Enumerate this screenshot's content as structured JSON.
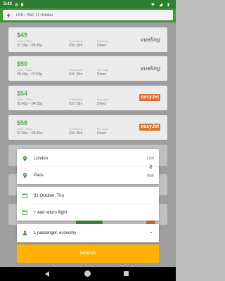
{
  "status_bar": {
    "time": "5:43"
  },
  "search": {
    "route": "LON • PAR, 31 October"
  },
  "flights": [
    {
      "price": "$49",
      "codes": "LON – ODG",
      "times": "07:25p – 09:35p",
      "travel_time_label": "Travel time",
      "travel_time": "01h 10m",
      "stops_label": "Non-stop",
      "stops": "Direct",
      "airline": "vueling"
    },
    {
      "price": "$50",
      "codes": "LON – ODG",
      "times": "06:40p – 07:50p",
      "travel_time_label": "Travel time",
      "travel_time": "01h 10m",
      "stops_label": "Non-stop",
      "stops": "Direct",
      "airline": "vueling"
    },
    {
      "price": "$54",
      "codes": "SEN – ODG",
      "times": "02:45p – 04:55p",
      "travel_time_label": "Travel time",
      "travel_time": "01h 10m",
      "stops_label": "Non-stop",
      "stops": "Direct",
      "airline": "easyJet"
    },
    {
      "price": "$58",
      "codes": "LON – ODG",
      "times": "07:05a – 09:30a",
      "travel_time_label": "Travel time",
      "travel_time": "01h 25m",
      "stops_label": "Non-stop",
      "stops": "Direct",
      "airline": "easyJet"
    }
  ],
  "form": {
    "origin": "London",
    "origin_code": "LON",
    "destination": "Paris",
    "destination_code": "PAR",
    "date": "31 October, Thu",
    "return": "+ Add return flight",
    "passengers": "1 passenger, economy",
    "search_label": "Search"
  },
  "colors": {
    "accent": "#3f9a3a",
    "price": "#5aa85a",
    "search": "#ffb300",
    "easyjet": "#e06e2d"
  }
}
